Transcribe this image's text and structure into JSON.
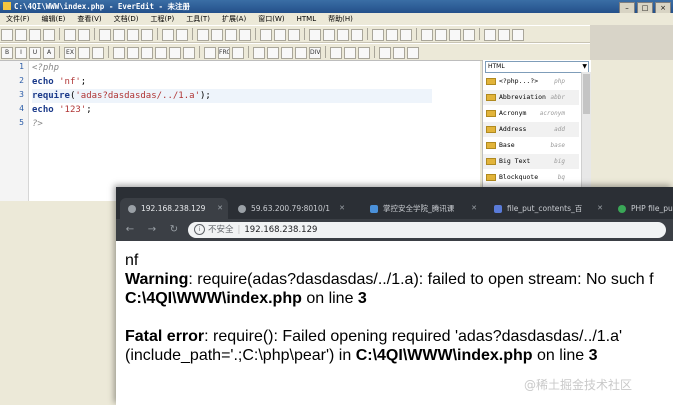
{
  "editor": {
    "title": "C:\\4QI\\WWW\\index.php - EverEdit - 未注册",
    "menu": [
      "文件(F)",
      "编辑(E)",
      "查看(V)",
      "文档(D)",
      "工程(P)",
      "工具(T)",
      "扩展(A)",
      "窗口(W)",
      "HTML",
      "帮助(H)"
    ],
    "toolbar2_labels": [
      "B",
      "I",
      "U",
      "A",
      "EX",
      "FRC",
      "DIV"
    ],
    "line_numbers": [
      "1",
      "2",
      "3",
      "4",
      "5"
    ],
    "code": {
      "l1": "<?php",
      "l2_kw": "echo",
      "l2_str": "'nf'",
      "l2_end": ";",
      "l3_kw": "require",
      "l3_open": "(",
      "l3_str": "'adas?dasdasdas/../1.a'",
      "l3_end": ");",
      "l4_kw": "echo",
      "l4_str": "'123'",
      "l4_end": ";",
      "l5": "?>"
    },
    "panel": {
      "select_value": "HTML",
      "items": [
        {
          "label": "<?php...?>",
          "tag": "php"
        },
        {
          "label": "Abbreviation",
          "tag": "abbr"
        },
        {
          "label": "Acronym",
          "tag": "acronym"
        },
        {
          "label": "Address",
          "tag": "add"
        },
        {
          "label": "Base",
          "tag": "base"
        },
        {
          "label": "Big Text",
          "tag": "big"
        },
        {
          "label": "Blockquote",
          "tag": "bq"
        }
      ]
    }
  },
  "browser": {
    "tabs": [
      {
        "title": "192.168.238.129",
        "icon_color": "#9aa0a6"
      },
      {
        "title": "59.63.200.79:8010/1",
        "icon_color": "#9aa0a6"
      },
      {
        "title": "掌控安全学院_腾讯课",
        "icon_color": "#4a90d9"
      },
      {
        "title": "file_put_contents_百",
        "icon_color": "#5a7bd8"
      },
      {
        "title": "PHP file_pu",
        "icon_color": "#3aa757"
      }
    ],
    "address": {
      "insecure_label": "不安全",
      "url": "192.168.238.129"
    },
    "output": {
      "line1": "nf",
      "warning_label": "Warning",
      "warning_text": ": require(adas?dasdasdas/../1.a): failed to open stream: No such f",
      "warning_path": "C:\\4QI\\WWW\\index.php",
      "warning_online": " on line ",
      "warning_line": "3",
      "fatal_label": "Fatal error",
      "fatal_text": ": require(): Failed opening required 'adas?dasdasdas/../1.a'",
      "fatal_text2": "(include_path='.;C:\\php\\pear') in ",
      "fatal_path": "C:\\4QI\\WWW\\index.php",
      "fatal_online": " on line ",
      "fatal_line": "3"
    }
  },
  "watermark": "@稀土掘金技术社区"
}
